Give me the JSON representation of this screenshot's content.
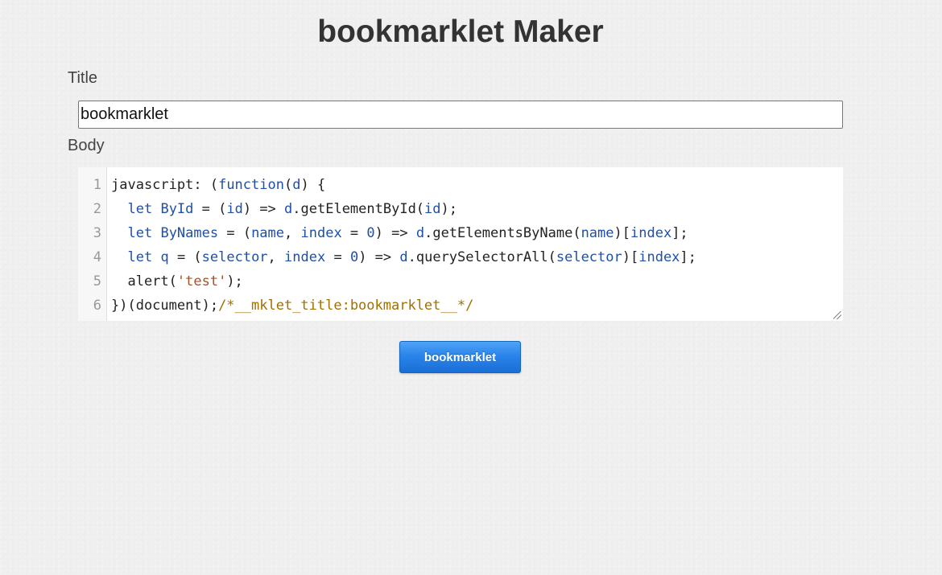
{
  "page": {
    "title": "bookmarklet Maker"
  },
  "form": {
    "title_label": "Title",
    "title_value": "bookmarklet",
    "body_label": "Body",
    "submit_label": "bookmarklet"
  },
  "editor": {
    "line_numbers": [
      "1",
      "2",
      "3",
      "4",
      "5",
      "6"
    ],
    "lines": [
      [
        {
          "t": "javascript: ",
          "c": ""
        },
        {
          "t": "(",
          "c": ""
        },
        {
          "t": "function",
          "c": "kw"
        },
        {
          "t": "(",
          "c": ""
        },
        {
          "t": "d",
          "c": "def"
        },
        {
          "t": ") {",
          "c": ""
        }
      ],
      [
        {
          "t": "  ",
          "c": ""
        },
        {
          "t": "let",
          "c": "kw"
        },
        {
          "t": " ",
          "c": ""
        },
        {
          "t": "ById",
          "c": "def"
        },
        {
          "t": " = (",
          "c": ""
        },
        {
          "t": "id",
          "c": "def"
        },
        {
          "t": ") => ",
          "c": ""
        },
        {
          "t": "d",
          "c": "var"
        },
        {
          "t": ".getElementById(",
          "c": ""
        },
        {
          "t": "id",
          "c": "var"
        },
        {
          "t": ");",
          "c": ""
        }
      ],
      [
        {
          "t": "  ",
          "c": ""
        },
        {
          "t": "let",
          "c": "kw"
        },
        {
          "t": " ",
          "c": ""
        },
        {
          "t": "ByNames",
          "c": "def"
        },
        {
          "t": " = (",
          "c": ""
        },
        {
          "t": "name",
          "c": "def"
        },
        {
          "t": ", ",
          "c": ""
        },
        {
          "t": "index",
          "c": "def"
        },
        {
          "t": " = ",
          "c": ""
        },
        {
          "t": "0",
          "c": "num"
        },
        {
          "t": ") => ",
          "c": ""
        },
        {
          "t": "d",
          "c": "var"
        },
        {
          "t": ".getElementsByName(",
          "c": ""
        },
        {
          "t": "name",
          "c": "var"
        },
        {
          "t": ")[",
          "c": ""
        },
        {
          "t": "index",
          "c": "var"
        },
        {
          "t": "];",
          "c": ""
        }
      ],
      [
        {
          "t": "  ",
          "c": ""
        },
        {
          "t": "let",
          "c": "kw"
        },
        {
          "t": " ",
          "c": ""
        },
        {
          "t": "q",
          "c": "def"
        },
        {
          "t": " = (",
          "c": ""
        },
        {
          "t": "selector",
          "c": "def"
        },
        {
          "t": ", ",
          "c": ""
        },
        {
          "t": "index",
          "c": "def"
        },
        {
          "t": " = ",
          "c": ""
        },
        {
          "t": "0",
          "c": "num"
        },
        {
          "t": ") => ",
          "c": ""
        },
        {
          "t": "d",
          "c": "var"
        },
        {
          "t": ".querySelectorAll(",
          "c": ""
        },
        {
          "t": "selector",
          "c": "var"
        },
        {
          "t": ")[",
          "c": ""
        },
        {
          "t": "index",
          "c": "var"
        },
        {
          "t": "];",
          "c": ""
        }
      ],
      [
        {
          "t": "  alert(",
          "c": ""
        },
        {
          "t": "'test'",
          "c": "str"
        },
        {
          "t": ");",
          "c": ""
        }
      ],
      [
        {
          "t": "})(document);",
          "c": ""
        },
        {
          "t": "/*__mklet_title:bookmarklet__*/",
          "c": "comment"
        }
      ]
    ]
  },
  "colors": {
    "background": "#efefef",
    "button_top": "#4fa3f7",
    "button_bottom": "#1a6fd6",
    "keyword": "#1f4fa8",
    "comment": "#a07000"
  }
}
